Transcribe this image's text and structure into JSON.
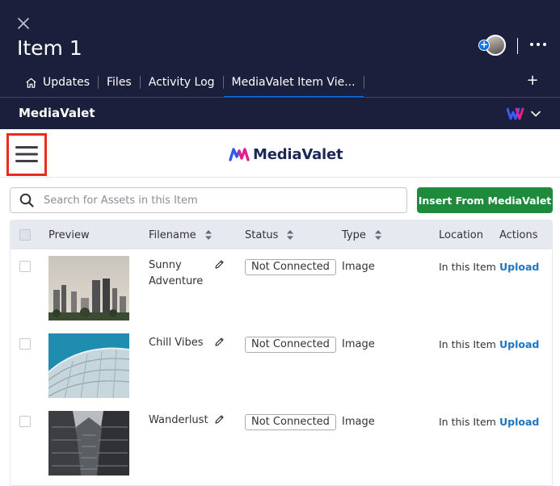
{
  "window": {
    "title": "Item 1",
    "tabs": [
      {
        "label": "Updates",
        "icon": "home-icon"
      },
      {
        "label": "Files"
      },
      {
        "label": "Activity Log"
      },
      {
        "label": "MediaValet Item Vie..."
      }
    ],
    "add_tab": "+"
  },
  "app_bar": {
    "label": "MediaValet"
  },
  "app": {
    "logo_text": "MediaValet",
    "search_placeholder": "Search for Assets in this Item",
    "insert_button": "Insert From MediaValet",
    "columns": {
      "preview": "Preview",
      "filename": "Filename",
      "status": "Status",
      "type": "Type",
      "location": "Location",
      "actions": "Actions"
    },
    "rows": [
      {
        "filename": "Sunny Adventure",
        "status": "Not Connected",
        "type": "Image",
        "location": "In this Item",
        "action": "Upload"
      },
      {
        "filename": "Chill Vibes",
        "status": "Not Connected",
        "type": "Image",
        "location": "In this Item",
        "action": "Upload"
      },
      {
        "filename": "Wanderlust",
        "status": "Not Connected",
        "type": "Image",
        "location": "In this Item",
        "action": "Upload"
      }
    ]
  },
  "colors": {
    "header_bg": "#1c1f3b",
    "accent": "#0073ea",
    "insert_green": "#1e8a3c",
    "upload_link": "#1f76c2",
    "highlight_box": "#ea2b1f"
  }
}
